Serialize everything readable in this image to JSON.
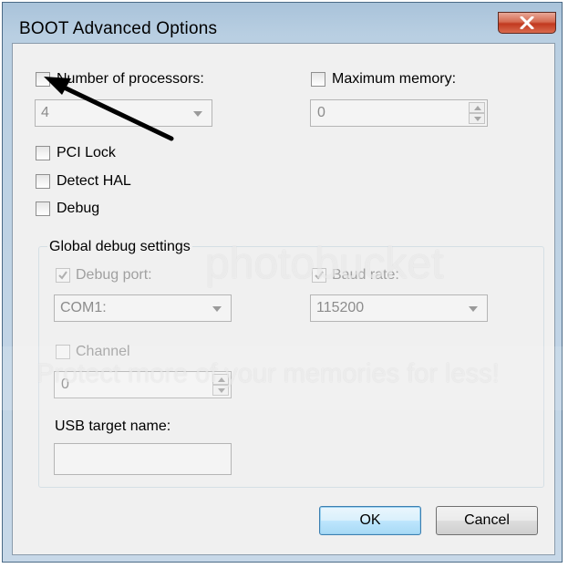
{
  "window": {
    "title": "BOOT Advanced Options"
  },
  "options": {
    "num_processors": {
      "label": "Number of processors:",
      "checked": false,
      "value": "4"
    },
    "max_memory": {
      "label": "Maximum memory:",
      "checked": false,
      "value": "0"
    },
    "pci_lock": {
      "label": "PCI Lock",
      "checked": false
    },
    "detect_hal": {
      "label": "Detect HAL",
      "checked": false
    },
    "debug": {
      "label": "Debug",
      "checked": false
    }
  },
  "debug_settings": {
    "group_title": "Global debug settings",
    "debug_port": {
      "label": "Debug port:",
      "checked": true,
      "value": "COM1:"
    },
    "baud_rate": {
      "label": "Baud rate:",
      "checked": true,
      "value": "115200"
    },
    "channel": {
      "label": "Channel",
      "checked": false,
      "value": "0"
    },
    "usb_target": {
      "label": "USB target name:",
      "value": ""
    }
  },
  "buttons": {
    "ok": "OK",
    "cancel": "Cancel"
  },
  "watermark": {
    "brand": "photobucket",
    "slogan": "Protect more of your memories for less!"
  },
  "colors": {
    "title_bar": "#b9cfe2",
    "close_red": "#c2391f",
    "ok_blue": "#3c7fb1",
    "annotation_arrow": "#000000"
  }
}
